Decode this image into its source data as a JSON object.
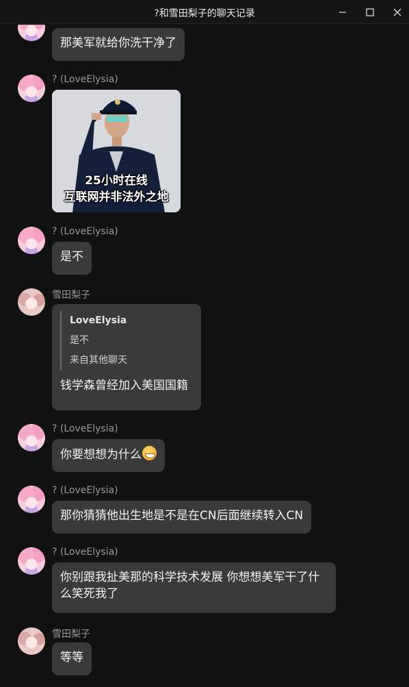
{
  "window": {
    "title": "?和雪田梨子的聊天记录",
    "minimize_label": "Minimize",
    "maximize_label": "Maximize",
    "close_label": "Close"
  },
  "messages": [
    {
      "sender": "",
      "text": "那美军就给你洗干净了"
    },
    {
      "sender": "? (LoveElysia)",
      "image_caption_line1": "25小时在线",
      "image_caption_line2": "互联网并非法外之地"
    },
    {
      "sender": "? (LoveElysia)",
      "text": "是不"
    },
    {
      "sender": "雪田梨子",
      "quote_title": "LoveElysia",
      "quote_text": "是不",
      "quote_source": "来自其他聊天",
      "text": "钱学森曾经加入美国国籍"
    },
    {
      "sender": "? (LoveElysia)",
      "text": "你要想想为什么",
      "emoji": "grinning-face-emoji"
    },
    {
      "sender": "? (LoveElysia)",
      "text": "那你猜猜他出生地是不是在CN后面继续转入CN"
    },
    {
      "sender": "? (LoveElysia)",
      "text": "你别跟我扯美那的科学技术发展 你想想美军干了什么笑死我了"
    },
    {
      "sender": "雪田梨子",
      "text": "等等"
    }
  ]
}
